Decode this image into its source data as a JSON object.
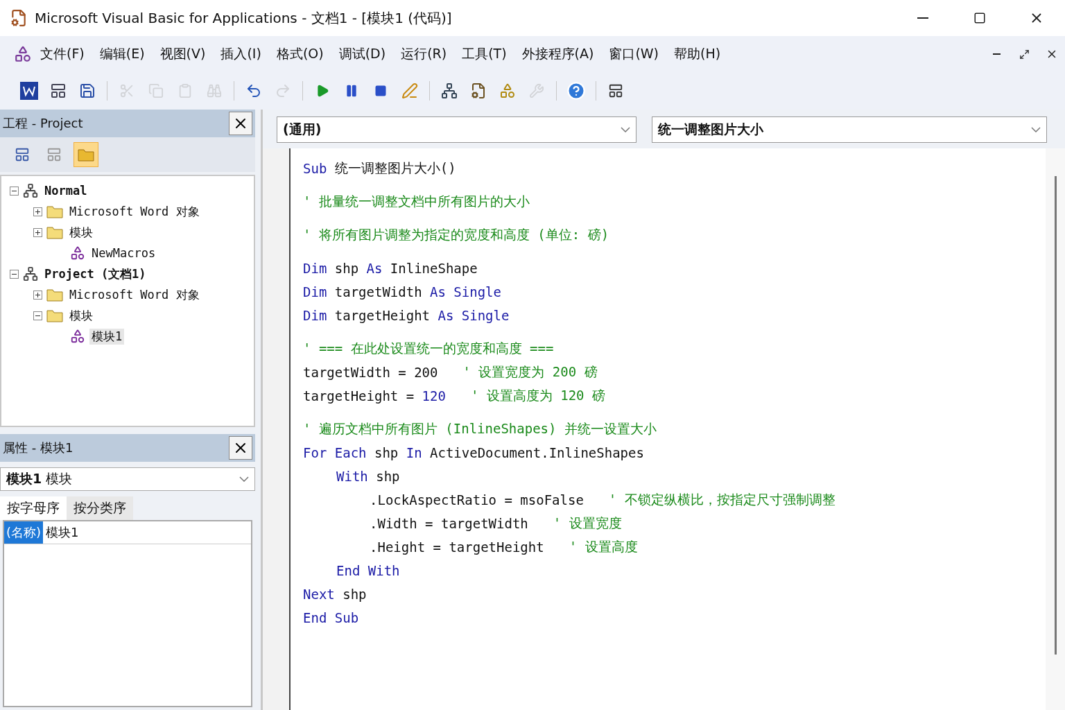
{
  "window": {
    "title": "Microsoft Visual Basic for Applications - 文档1 - [模块1 (代码)]"
  },
  "menu": [
    "文件(F)",
    "编辑(E)",
    "视图(V)",
    "插入(I)",
    "格式(O)",
    "调试(D)",
    "运行(R)",
    "工具(T)",
    "外接程序(A)",
    "窗口(W)",
    "帮助(H)"
  ],
  "toolbar": [
    {
      "kind": "word",
      "disabled": false
    },
    {
      "kind": "insert",
      "disabled": false
    },
    {
      "kind": "save",
      "disabled": false
    },
    {
      "kind": "sep"
    },
    {
      "kind": "cut",
      "disabled": true
    },
    {
      "kind": "copy",
      "disabled": true
    },
    {
      "kind": "paste",
      "disabled": true
    },
    {
      "kind": "find",
      "disabled": true
    },
    {
      "kind": "sep"
    },
    {
      "kind": "undo",
      "disabled": false
    },
    {
      "kind": "redo",
      "disabled": true
    },
    {
      "kind": "sep"
    },
    {
      "kind": "run",
      "disabled": false
    },
    {
      "kind": "pause",
      "disabled": false
    },
    {
      "kind": "stop",
      "disabled": false
    },
    {
      "kind": "design",
      "disabled": false
    },
    {
      "kind": "sep"
    },
    {
      "kind": "project",
      "disabled": false
    },
    {
      "kind": "properties",
      "disabled": false
    },
    {
      "kind": "objects",
      "disabled": false
    },
    {
      "kind": "tools",
      "disabled": true
    },
    {
      "kind": "sep"
    },
    {
      "kind": "help",
      "disabled": false
    },
    {
      "kind": "sep"
    },
    {
      "kind": "position",
      "disabled": false
    }
  ],
  "project_panel": {
    "title": "工程 - Project",
    "tree": [
      {
        "label": "Normal",
        "kind": "project",
        "expanded": true,
        "selected": false,
        "children": [
          {
            "label": "Microsoft Word 对象",
            "kind": "folder",
            "expanded": false,
            "selected": false
          },
          {
            "label": "模块",
            "kind": "folder",
            "expanded": false,
            "selected": false,
            "children": [
              {
                "label": "NewMacros",
                "kind": "module",
                "selected": false
              }
            ]
          }
        ]
      },
      {
        "label": "Project (文档1)",
        "kind": "project",
        "expanded": true,
        "selected": false,
        "children": [
          {
            "label": "Microsoft Word 对象",
            "kind": "folder",
            "expanded": false,
            "selected": false
          },
          {
            "label": "模块",
            "kind": "folder",
            "expanded": true,
            "selected": false,
            "children": [
              {
                "label": "模块1",
                "kind": "module",
                "selected": true
              }
            ]
          }
        ]
      }
    ]
  },
  "properties_panel": {
    "title": "属性 - 模块1",
    "object": "**模块1** 模块",
    "tabs": [
      {
        "label": "按字母序",
        "selected": true
      },
      {
        "label": "按分类序",
        "selected": false
      }
    ],
    "rows": [
      {
        "name": "(名称)",
        "value": "模块1",
        "selected": true
      }
    ]
  },
  "code_window": {
    "object_dropdown": "(通用)",
    "procedure_dropdown": "统一调整图片大小",
    "lines": [
      {
        "space_before": false,
        "segments": [
          {
            "kind": "keyword",
            "text": "Sub"
          },
          {
            "kind": "plain",
            "text": " 统一调整图片大小()"
          }
        ]
      },
      {
        "space_before": true,
        "segments": [
          {
            "kind": "comment",
            "text": "' 批量统一调整文档中所有图片的大小"
          }
        ]
      },
      {
        "space_before": true,
        "segments": [
          {
            "kind": "comment",
            "text": "' 将所有图片调整为指定的宽度和高度 (单位: 磅)"
          }
        ]
      },
      {
        "space_before": true,
        "segments": [
          {
            "kind": "keyword",
            "text": "Dim"
          },
          {
            "kind": "plain",
            "text": " shp "
          },
          {
            "kind": "keyword",
            "text": "As"
          },
          {
            "kind": "plain",
            "text": " InlineShape"
          }
        ]
      },
      {
        "space_before": false,
        "segments": [
          {
            "kind": "keyword",
            "text": "Dim"
          },
          {
            "kind": "plain",
            "text": " targetWidth "
          },
          {
            "kind": "keyword",
            "text": "As Single"
          }
        ]
      },
      {
        "space_before": false,
        "segments": [
          {
            "kind": "keyword",
            "text": "Dim"
          },
          {
            "kind": "plain",
            "text": " targetHeight "
          },
          {
            "kind": "keyword",
            "text": "As Single"
          }
        ]
      },
      {
        "space_before": true,
        "segments": [
          {
            "kind": "comment",
            "text": "' === 在此处设置统一的宽度和高度 ==="
          }
        ]
      },
      {
        "space_before": false,
        "segments": [
          {
            "kind": "plain",
            "text": "targetWidth = 200"
          },
          {
            "kind": "trailing_comment",
            "text": "' 设置宽度为 200 磅"
          }
        ]
      },
      {
        "space_before": false,
        "segments": [
          {
            "kind": "plain",
            "text": "targetHeight = "
          },
          {
            "kind": "keyword",
            "text": "120"
          },
          {
            "kind": "trailing_comment",
            "text": "' 设置高度为 120 磅"
          }
        ]
      },
      {
        "space_before": true,
        "segments": [
          {
            "kind": "comment",
            "text": "' 遍历文档中所有图片 (InlineShapes) 并统一设置大小"
          }
        ]
      },
      {
        "space_before": false,
        "segments": [
          {
            "kind": "keyword",
            "text": "For Each"
          },
          {
            "kind": "plain",
            "text": " shp "
          },
          {
            "kind": "keyword",
            "text": "In"
          },
          {
            "kind": "plain",
            "text": " ActiveDocument.InlineShapes"
          }
        ],
        "children": [
          {
            "space_before": false,
            "segments": [
              {
                "kind": "keyword",
                "text": "With"
              },
              {
                "kind": "plain",
                "text": " shp"
              }
            ],
            "children": [
              {
                "space_before": false,
                "segments": [
                  {
                    "kind": "plain",
                    "text": ".LockAspectRatio = msoFalse"
                  },
                  {
                    "kind": "trailing_comment",
                    "text": "' 不锁定纵横比，按指定尺寸强制调整"
                  }
                ]
              },
              {
                "space_before": false,
                "segments": [
                  {
                    "kind": "plain",
                    "text": ".Width = targetWidth"
                  },
                  {
                    "kind": "trailing_comment",
                    "text": "' 设置宽度"
                  }
                ]
              },
              {
                "space_before": false,
                "segments": [
                  {
                    "kind": "plain",
                    "text": ".Height = targetHeight"
                  },
                  {
                    "kind": "trailing_comment",
                    "text": "' 设置高度"
                  }
                ]
              }
            ]
          },
          {
            "space_before": false,
            "segments": [
              {
                "kind": "keyword",
                "text": "End With"
              }
            ]
          }
        ]
      },
      {
        "space_before": false,
        "segments": [
          {
            "kind": "keyword",
            "text": "Next"
          },
          {
            "kind": "plain",
            "text": " shp"
          }
        ]
      },
      {
        "space_before": false,
        "segments": [
          {
            "kind": "keyword",
            "text": "End Sub"
          }
        ]
      }
    ]
  }
}
